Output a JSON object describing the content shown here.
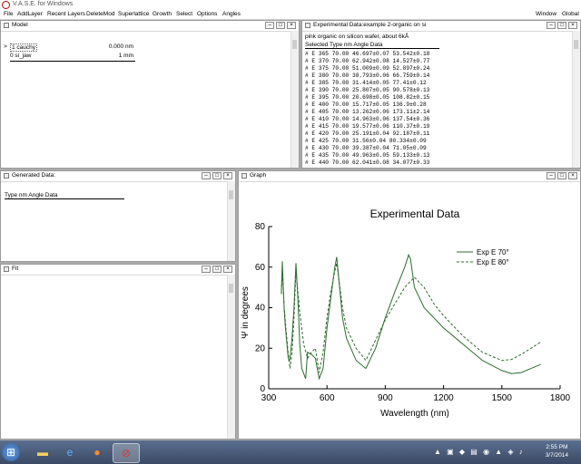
{
  "app": {
    "title": "V.A.S.E. for Windows"
  },
  "menu": {
    "left": [
      "File",
      "AddLayer",
      "Recent Layers",
      "DeleteMod",
      "Superlattice",
      "Growth",
      "Select",
      "Options",
      "Angles"
    ],
    "right": [
      "Window",
      "Global"
    ]
  },
  "model": {
    "title": "Model",
    "layers": [
      {
        "marker": ">",
        "name": "1 cauchy",
        "value": "0.000 nm"
      },
      {
        "marker": "",
        "name": "0 si_jaw",
        "value": "1 mm"
      }
    ]
  },
  "experimental": {
    "title": "Experimental Data:example 2-organic on si",
    "subtitle": "pink organic on silicon wafer, about 6kÅ",
    "header": "Selected Type  nm  Angle  Data",
    "rows": [
      "# E  365  70.00  46.697±0.07  53.542±0.18",
      "# E  370  70.00  62.942±0.08  14.527±0.77",
      "# E  375  70.00  51.009±0.09  52.897±0.24",
      "# E  380  70.00  38.793±0.06  66.759±0.14",
      "# E  385  70.00  31.414±0.05  77.41±0.12",
      "# E  390  70.00  25.807±0.05  90.578±0.13",
      "# E  395  70.00  20.698±0.05  108.82±0.15",
      "# E  400  70.00  15.717±0.05  136.9±0.28",
      "# E  405  70.00  13.262±0.06  173.11±2.14",
      "# E  410  70.00  14.963±0.06  137.54±0.36",
      "# E  415  70.00  19.577±0.06  110.37±0.19",
      "# E  420  70.00  25.191±0.04  92.187±0.11",
      "# E  425  70.00  31.56±0.04  80.334±0.09",
      "# E  430  70.00  39.387±0.04  71.05±0.09",
      "# E  435  70.00  49.963±0.05  59.133±0.13",
      "# E  440  70.00  62.041±0.08  34.077±0.33"
    ]
  },
  "generated": {
    "title": "Generated Data:",
    "header": "Type  nm  Angle  Data"
  },
  "fit": {
    "title": "Fit"
  },
  "graph": {
    "title": "Graph"
  },
  "chart_data": {
    "type": "line",
    "title": "Experimental Data",
    "xlabel": "Wavelength (nm)",
    "ylabel": "Ψ in degrees",
    "xlim": [
      300,
      1800
    ],
    "ylim": [
      0,
      80
    ],
    "xticks": [
      "300",
      "600",
      "900",
      "1200",
      "1500",
      "1800"
    ],
    "yticks": [
      "0",
      "20",
      "40",
      "60",
      "80"
    ],
    "legend_position": "top-right",
    "series": [
      {
        "name": "Exp E 70°",
        "style": "solid",
        "x": [
          365,
          370,
          375,
          380,
          385,
          390,
          400,
          405,
          410,
          420,
          430,
          440,
          450,
          460,
          470,
          490,
          500,
          520,
          540,
          560,
          580,
          600,
          620,
          640,
          650,
          660,
          680,
          700,
          750,
          800,
          850,
          900,
          950,
          1000,
          1020,
          1030,
          1050,
          1100,
          1200,
          1300,
          1400,
          1500,
          1550,
          1600,
          1650,
          1700
        ],
        "y": [
          46.7,
          62.9,
          51.0,
          38.8,
          31.4,
          25.8,
          15.7,
          13.3,
          15.0,
          25.2,
          39.4,
          62.0,
          45.0,
          22.0,
          10.0,
          5.0,
          18.0,
          17.0,
          15.0,
          5.0,
          10.0,
          30.0,
          45.0,
          60.0,
          65.0,
          55.0,
          35.0,
          25.0,
          14.0,
          10.0,
          20.0,
          35.0,
          48.0,
          60.0,
          66.0,
          64.0,
          50.0,
          40.0,
          30.0,
          22.0,
          14.0,
          9.0,
          7.5,
          8.0,
          10.0,
          12.0
        ]
      },
      {
        "name": "Exp E 80°",
        "style": "dashed",
        "x": [
          365,
          370,
          375,
          380,
          390,
          400,
          410,
          420,
          430,
          440,
          460,
          480,
          500,
          520,
          540,
          560,
          580,
          600,
          620,
          640,
          650,
          660,
          680,
          700,
          750,
          800,
          850,
          900,
          950,
          1000,
          1050,
          1100,
          1150,
          1200,
          1300,
          1400,
          1500,
          1550,
          1600,
          1650,
          1700
        ],
        "y": [
          48.0,
          58.0,
          50.0,
          40.0,
          28.0,
          18.0,
          10.0,
          18.0,
          35.0,
          58.0,
          38.0,
          22.0,
          15.0,
          18.0,
          20.0,
          8.0,
          18.0,
          35.0,
          48.0,
          58.0,
          62.0,
          55.0,
          40.0,
          30.0,
          20.0,
          14.0,
          24.0,
          34.0,
          42.0,
          50.0,
          55.0,
          50.0,
          42.0,
          36.0,
          26.0,
          18.0,
          14.0,
          14.5,
          17.0,
          20.0,
          23.0
        ]
      }
    ]
  },
  "taskbar": {
    "time": "2:55 PM",
    "date": "3/7/2014"
  }
}
